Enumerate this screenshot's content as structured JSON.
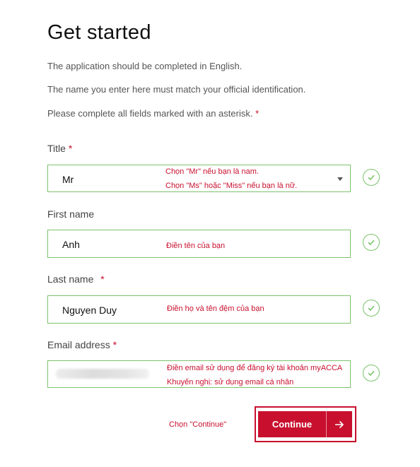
{
  "page": {
    "title": "Get started",
    "intro": [
      "The application should be completed in English.",
      "The name you enter here must match your official identification.",
      "Please complete all fields marked with an asterisk."
    ],
    "asterisk": "*"
  },
  "form": {
    "title": {
      "label": "Title",
      "value": "Mr",
      "note_line1": "Chọn \"Mr\" nếu bạn là nam.",
      "note_line2": "Chọn \"Ms\" hoặc \"Miss\" nếu bạn là nữ."
    },
    "first_name": {
      "label": "First name",
      "value": "Anh",
      "note": "Điền tên của bạn"
    },
    "last_name": {
      "label": "Last name",
      "value": "Nguyen Duy",
      "note": "Điền họ và tên đệm của bạn"
    },
    "email": {
      "label": "Email address",
      "value": "",
      "note_line1": "Điền email sử dụng để đăng ký tài khoản myACCA",
      "note_line2": "Khuyến nghị: sử dụng email cá nhân"
    }
  },
  "actions": {
    "continue_note": "Chọn \"Continue\"",
    "continue_label": "Continue"
  },
  "colors": {
    "accent_red": "#c8102e",
    "valid_green": "#7cc36b"
  },
  "icons": {
    "valid": "check-circle-icon",
    "dropdown": "chevron-down-icon",
    "continue": "arrow-right-icon"
  }
}
